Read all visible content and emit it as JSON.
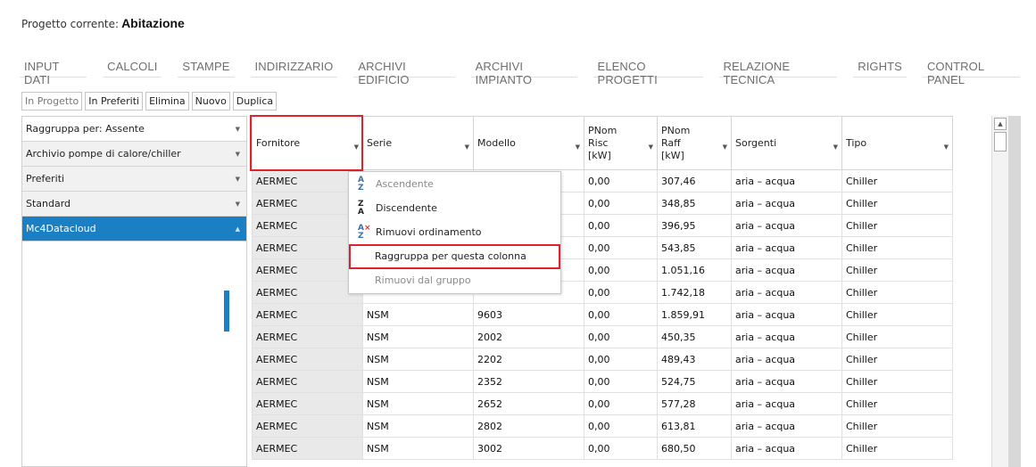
{
  "project": {
    "label": "Progetto corrente:",
    "name": "Abitazione"
  },
  "nav": [
    "INPUT DATI",
    "CALCOLI",
    "STAMPE",
    "INDIRIZZARIO",
    "ARCHIVI EDIFICIO",
    "ARCHIVI IMPIANTO",
    "ELENCO PROGETTI",
    "RELAZIONE TECNICA",
    "RIGHTS",
    "CONTROL PANEL"
  ],
  "toolbar": [
    "In Progetto",
    "In Preferiti",
    "Elimina",
    "Nuovo",
    "Duplica"
  ],
  "left": {
    "group_by": "Raggruppa per:  Assente",
    "items": [
      "Archivio pompe di calore/chiller",
      "Preferiti",
      "Standard",
      "Mc4Datacloud"
    ]
  },
  "grid": {
    "columns": [
      "Fornitore",
      "Serie",
      "Modello",
      "PNom Risc [kW]",
      "PNom Raff [kW]",
      "Sorgenti",
      "Tipo"
    ],
    "rows": [
      [
        "AERMEC",
        "",
        "",
        "0,00",
        "307,46",
        "aria – acqua",
        "Chiller"
      ],
      [
        "AERMEC",
        "",
        "",
        "0,00",
        "348,85",
        "aria – acqua",
        "Chiller"
      ],
      [
        "AERMEC",
        "",
        "",
        "0,00",
        "396,95",
        "aria – acqua",
        "Chiller"
      ],
      [
        "AERMEC",
        "",
        "",
        "0,00",
        "543,85",
        "aria – acqua",
        "Chiller"
      ],
      [
        "AERMEC",
        "",
        "",
        "0,00",
        "1.051,16",
        "aria – acqua",
        "Chiller"
      ],
      [
        "AERMEC",
        "",
        "",
        "0,00",
        "1.742,18",
        "aria – acqua",
        "Chiller"
      ],
      [
        "AERMEC",
        "NSM",
        "9603",
        "0,00",
        "1.859,91",
        "aria – acqua",
        "Chiller"
      ],
      [
        "AERMEC",
        "NSM",
        "2002",
        "0,00",
        "450,35",
        "aria – acqua",
        "Chiller"
      ],
      [
        "AERMEC",
        "NSM",
        "2202",
        "0,00",
        "489,43",
        "aria – acqua",
        "Chiller"
      ],
      [
        "AERMEC",
        "NSM",
        "2352",
        "0,00",
        "524,75",
        "aria – acqua",
        "Chiller"
      ],
      [
        "AERMEC",
        "NSM",
        "2652",
        "0,00",
        "577,28",
        "aria – acqua",
        "Chiller"
      ],
      [
        "AERMEC",
        "NSM",
        "2802",
        "0,00",
        "613,81",
        "aria – acqua",
        "Chiller"
      ],
      [
        "AERMEC",
        "NSM",
        "3002",
        "0,00",
        "680,50",
        "aria – acqua",
        "Chiller"
      ]
    ]
  },
  "menu": {
    "ascending": "Ascendente",
    "descending": "Discendente",
    "remove_sort": "Rimuovi ordinamento",
    "group_column": "Raggruppa per questa colonna",
    "remove_group": "Rimuovi dal gruppo"
  },
  "colors": {
    "accent": "#1b7fc4",
    "highlight": "#e0232a"
  }
}
